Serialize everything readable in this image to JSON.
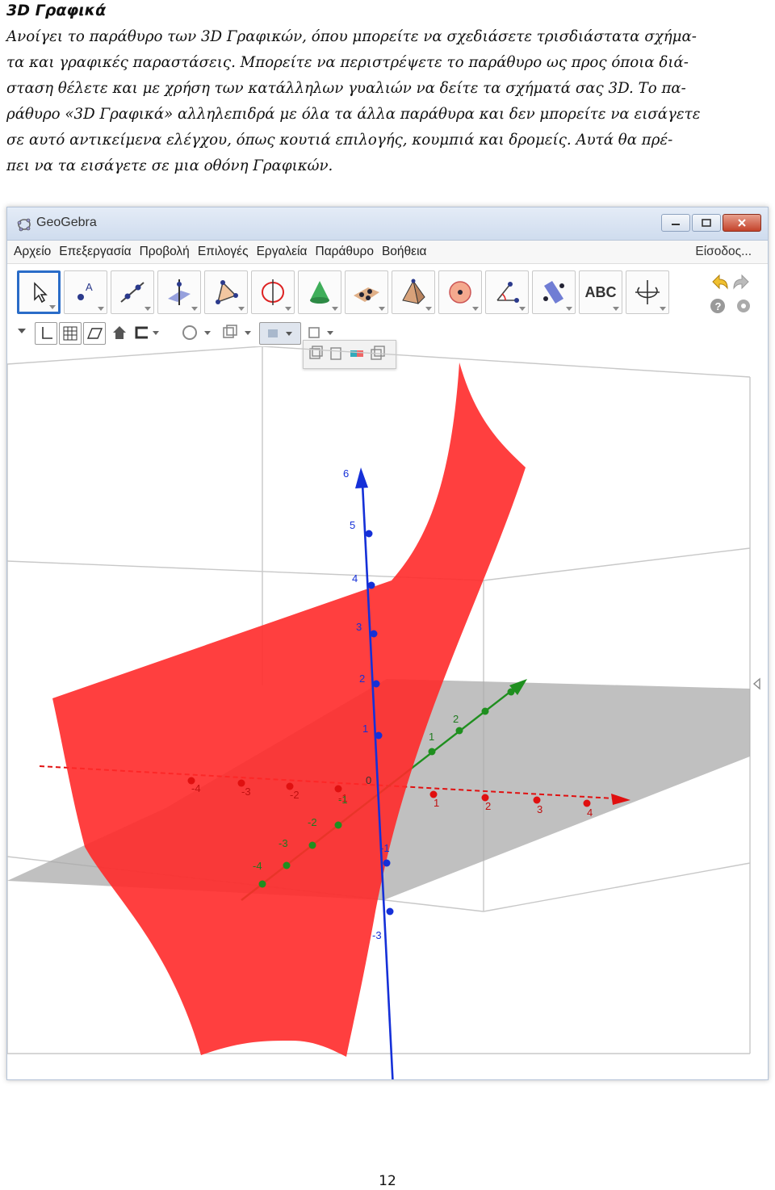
{
  "section": {
    "title": "3D Γραφικά"
  },
  "paragraph": {
    "lines": [
      "Ανοίγει το παράθυρο των 3D Γραφικών, όπου μπορείτε να σχεδιάσετε τρισδιάστατα σχήμα-",
      "τα και γραφικές παραστάσεις. Μπορείτε να περιστρέψετε το παράθυρο ως προς όποια διά-",
      "σταση θέλετε και με χρήση των κατάλληλων γυαλιών να δείτε τα σχήματά σας 3D. Το πα-",
      "ράθυρο «3D Γραφικά» αλληλεπιδρά με όλα τα άλλα παράθυρα και δεν μπορείτε να εισάγετε",
      "σε αυτό αντικείμενα ελέγχου, όπως κουτιά επιλογής, κουμπιά και δρομείς. Αυτά θα πρέ-",
      "πει να τα εισάγετε σε μια οθόνη Γραφικών."
    ]
  },
  "window": {
    "app_name": "GeoGebra",
    "menu": [
      "Αρχείο",
      "Επεξεργασία",
      "Προβολή",
      "Επιλογές",
      "Εργαλεία",
      "Παράθυρο",
      "Βοήθεια"
    ],
    "login": "Είσοδος...",
    "text_tool_label": "ABC"
  },
  "view3d": {
    "surface_color": "#ff2a2a",
    "axis_colors": {
      "x": "#e01010",
      "y": "#1f8f1f",
      "z": "#1530d8"
    },
    "z_labels": [
      "6",
      "5",
      "4",
      "3",
      "2",
      "1",
      "-1",
      "-3"
    ],
    "x_labels": [
      "-4",
      "-3",
      "-2",
      "-1",
      "1",
      "2",
      "3",
      "4"
    ],
    "y_labels": [
      "-4",
      "-3",
      "-2",
      "-1",
      "1",
      "2"
    ],
    "origin_label": "0"
  },
  "page": {
    "number": "12"
  }
}
